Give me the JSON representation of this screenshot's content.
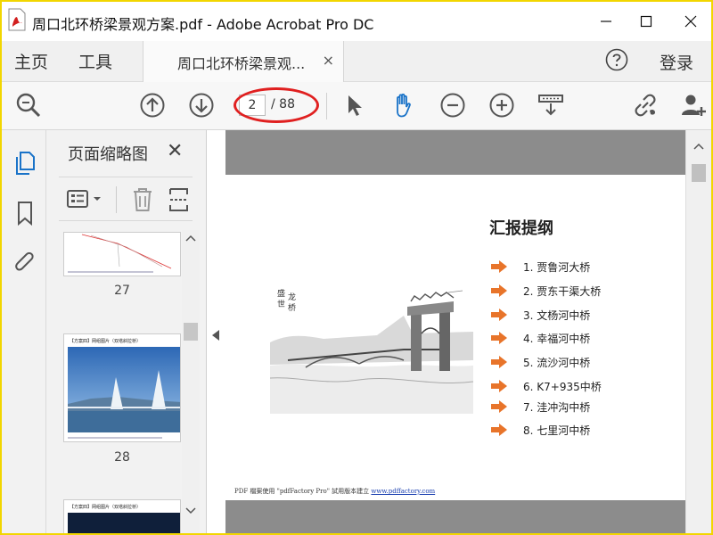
{
  "window": {
    "title": "周口北环桥梁景观方案.pdf - Adobe Acrobat Pro DC",
    "minimize_icon": "minimize-icon",
    "maximize_icon": "maximize-icon",
    "close_icon": "close-icon"
  },
  "nav": {
    "home": "主页",
    "tools": "工具",
    "doc_tab": "周口北环桥梁景观...",
    "doc_tab_close": "×",
    "login": "登录"
  },
  "toolbar": {
    "current_page": "2",
    "total_pages": "/ 88"
  },
  "thumbnails": {
    "title": "页面缩略图",
    "close": "✕",
    "items": [
      {
        "page": "27"
      },
      {
        "page": "28",
        "header": "【方案四】网组图片（双塔斜拉桥）"
      },
      {
        "header": "【方案四】网组图片（双塔斜拉桥）"
      }
    ]
  },
  "document": {
    "heading": "汇报提纲",
    "outline": [
      "1. 贾鲁河大桥",
      "2. 贾东干渠大桥",
      "3. 文杨河中桥",
      "4. 幸福河中桥",
      "5. 流沙河中桥",
      "6. K7+935中桥",
      "7. 洼冲沟中桥",
      "8. 七里河中桥"
    ],
    "footer_text": "PDF 檔案使用 \"pdfFactory Pro\" 試用版本建立",
    "footer_link": "www.pdffactory.com"
  },
  "colors": {
    "accent_blue": "#1a73c8",
    "arrow_orange": "#e8742a",
    "annotation_red": "#e02020"
  }
}
